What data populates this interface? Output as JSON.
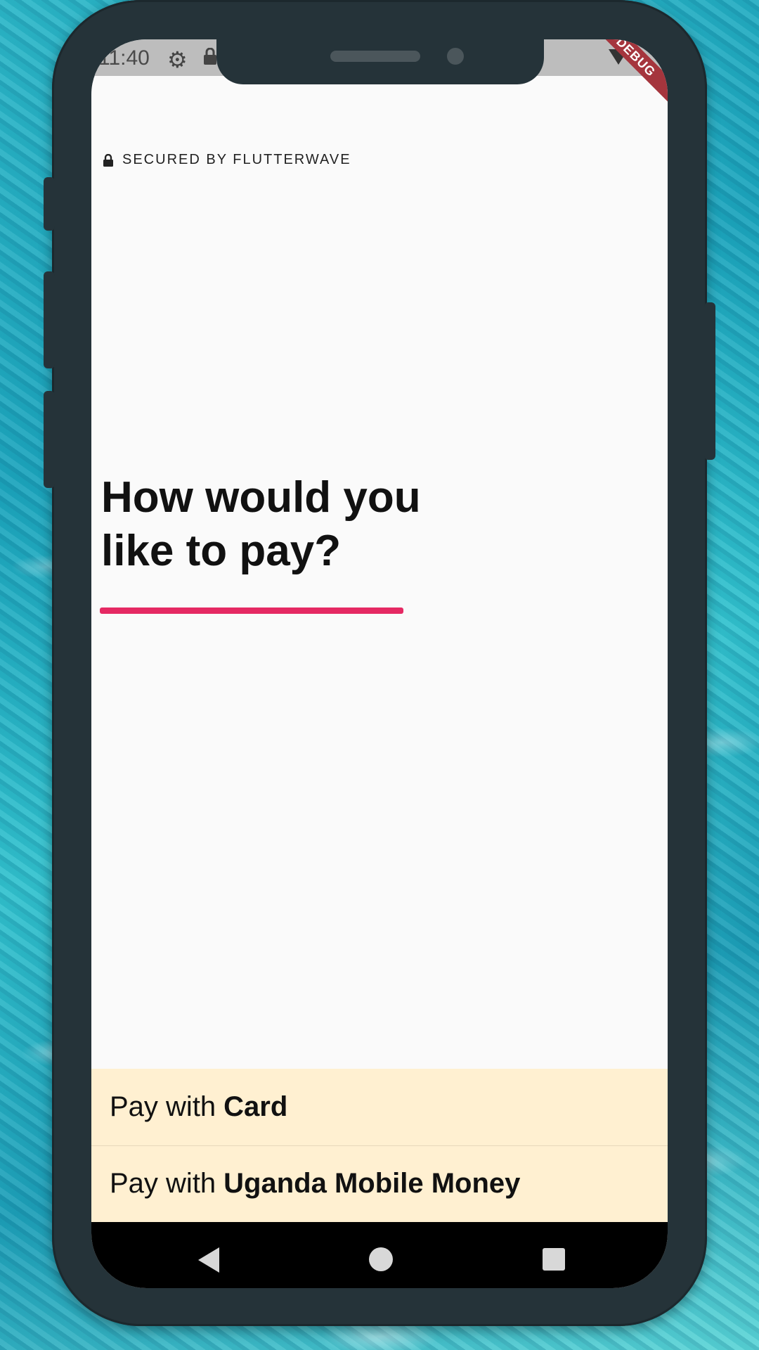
{
  "status_bar": {
    "time": "11:40",
    "icons": [
      "gear-icon",
      "lock-icon",
      "wifi-icon"
    ]
  },
  "debug_banner": "DEBUG",
  "secured": {
    "text": "SECURED BY FLUTTERWAVE",
    "icon": "lock-icon"
  },
  "headline": "How would you like to pay?",
  "accent_color": "#e52963",
  "payment_options": [
    {
      "prefix": "Pay with",
      "method": "Card"
    },
    {
      "prefix": "Pay with",
      "method": "Uganda Mobile Money"
    }
  ],
  "options_background": "#fff0d1",
  "nav_bar": {
    "icons": [
      "back-icon",
      "home-icon",
      "recents-icon"
    ]
  }
}
